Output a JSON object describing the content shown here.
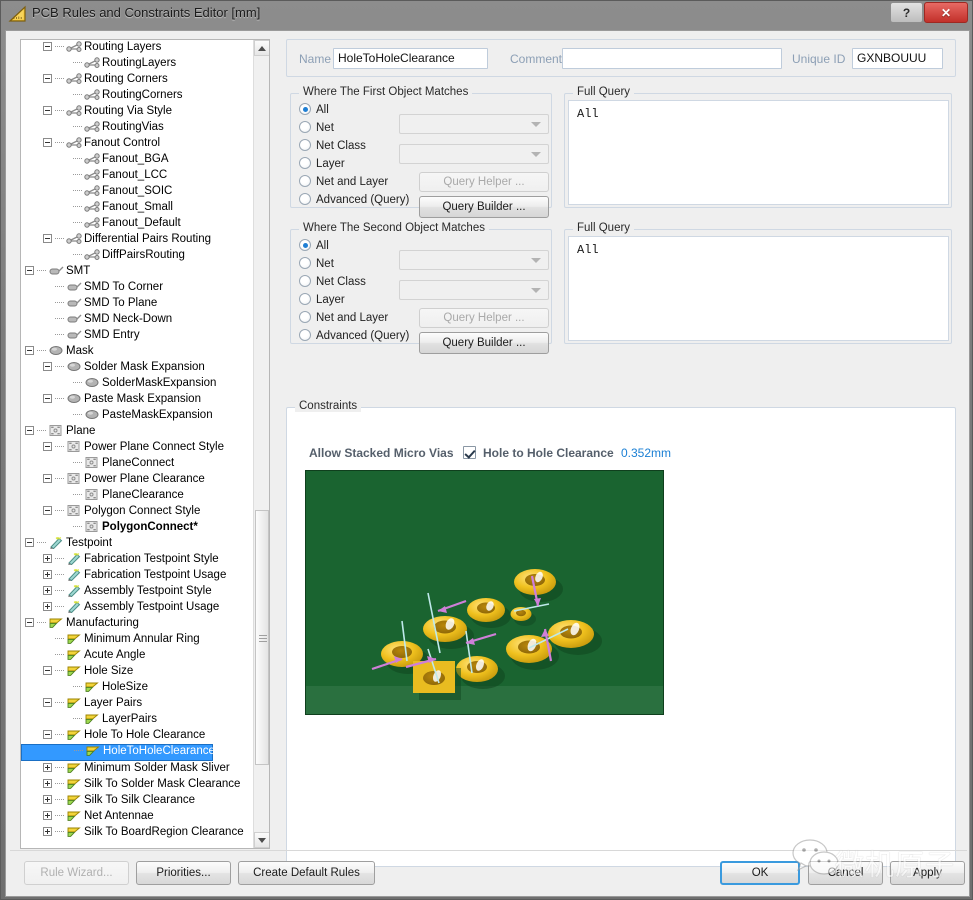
{
  "window": {
    "title": "PCB Rules and Constraints Editor [mm]",
    "icon": "ruler-triangle-icon",
    "help_label": "?",
    "close_label": "✕"
  },
  "tree": {
    "items": [
      {
        "label": "Routing Layers",
        "indent": 2,
        "expander": "minus",
        "icon": "routing-icon"
      },
      {
        "label": "RoutingLayers",
        "indent": 3,
        "expander": "none",
        "icon": "routing-icon"
      },
      {
        "label": "Routing Corners",
        "indent": 2,
        "expander": "minus",
        "icon": "routing-icon"
      },
      {
        "label": "RoutingCorners",
        "indent": 3,
        "expander": "none",
        "icon": "routing-icon"
      },
      {
        "label": "Routing Via Style",
        "indent": 2,
        "expander": "minus",
        "icon": "routing-icon"
      },
      {
        "label": "RoutingVias",
        "indent": 3,
        "expander": "none",
        "icon": "routing-icon"
      },
      {
        "label": "Fanout Control",
        "indent": 2,
        "expander": "minus",
        "icon": "routing-icon"
      },
      {
        "label": "Fanout_BGA",
        "indent": 3,
        "expander": "none",
        "icon": "routing-icon"
      },
      {
        "label": "Fanout_LCC",
        "indent": 3,
        "expander": "none",
        "icon": "routing-icon"
      },
      {
        "label": "Fanout_SOIC",
        "indent": 3,
        "expander": "none",
        "icon": "routing-icon"
      },
      {
        "label": "Fanout_Small",
        "indent": 3,
        "expander": "none",
        "icon": "routing-icon"
      },
      {
        "label": "Fanout_Default",
        "indent": 3,
        "expander": "none",
        "icon": "routing-icon"
      },
      {
        "label": "Differential Pairs Routing",
        "indent": 2,
        "expander": "minus",
        "icon": "routing-icon"
      },
      {
        "label": "DiffPairsRouting",
        "indent": 3,
        "expander": "none",
        "icon": "routing-icon"
      },
      {
        "label": "SMT",
        "indent": 1,
        "expander": "minus",
        "icon": "smt-icon"
      },
      {
        "label": "SMD To Corner",
        "indent": 2,
        "expander": "none",
        "icon": "smt-icon"
      },
      {
        "label": "SMD To Plane",
        "indent": 2,
        "expander": "none",
        "icon": "smt-icon"
      },
      {
        "label": "SMD Neck-Down",
        "indent": 2,
        "expander": "none",
        "icon": "smt-icon"
      },
      {
        "label": "SMD Entry",
        "indent": 2,
        "expander": "none",
        "icon": "smt-icon"
      },
      {
        "label": "Mask",
        "indent": 1,
        "expander": "minus",
        "icon": "mask-icon"
      },
      {
        "label": "Solder Mask Expansion",
        "indent": 2,
        "expander": "minus",
        "icon": "mask-icon"
      },
      {
        "label": "SolderMaskExpansion",
        "indent": 3,
        "expander": "none",
        "icon": "mask-icon"
      },
      {
        "label": "Paste Mask Expansion",
        "indent": 2,
        "expander": "minus",
        "icon": "mask-icon"
      },
      {
        "label": "PasteMaskExpansion",
        "indent": 3,
        "expander": "none",
        "icon": "mask-icon"
      },
      {
        "label": "Plane",
        "indent": 1,
        "expander": "minus",
        "icon": "plane-icon"
      },
      {
        "label": "Power Plane Connect Style",
        "indent": 2,
        "expander": "minus",
        "icon": "plane-icon"
      },
      {
        "label": "PlaneConnect",
        "indent": 3,
        "expander": "none",
        "icon": "plane-icon"
      },
      {
        "label": "Power Plane Clearance",
        "indent": 2,
        "expander": "minus",
        "icon": "plane-icon"
      },
      {
        "label": "PlaneClearance",
        "indent": 3,
        "expander": "none",
        "icon": "plane-icon"
      },
      {
        "label": "Polygon Connect Style",
        "indent": 2,
        "expander": "minus",
        "icon": "plane-icon"
      },
      {
        "label": "PolygonConnect*",
        "indent": 3,
        "expander": "none",
        "icon": "plane-icon",
        "bold": true
      },
      {
        "label": "Testpoint",
        "indent": 1,
        "expander": "minus",
        "icon": "testpoint-icon"
      },
      {
        "label": "Fabrication Testpoint Style",
        "indent": 2,
        "expander": "plus",
        "icon": "testpoint-icon"
      },
      {
        "label": "Fabrication Testpoint Usage",
        "indent": 2,
        "expander": "plus",
        "icon": "testpoint-icon"
      },
      {
        "label": "Assembly Testpoint Style",
        "indent": 2,
        "expander": "plus",
        "icon": "testpoint-icon"
      },
      {
        "label": "Assembly Testpoint Usage",
        "indent": 2,
        "expander": "plus",
        "icon": "testpoint-icon"
      },
      {
        "label": "Manufacturing",
        "indent": 1,
        "expander": "minus",
        "icon": "manufacturing-icon"
      },
      {
        "label": "Minimum Annular Ring",
        "indent": 2,
        "expander": "none",
        "icon": "manufacturing-icon"
      },
      {
        "label": "Acute Angle",
        "indent": 2,
        "expander": "none",
        "icon": "manufacturing-icon"
      },
      {
        "label": "Hole Size",
        "indent": 2,
        "expander": "minus",
        "icon": "manufacturing-icon"
      },
      {
        "label": "HoleSize",
        "indent": 3,
        "expander": "none",
        "icon": "manufacturing-icon"
      },
      {
        "label": "Layer Pairs",
        "indent": 2,
        "expander": "minus",
        "icon": "manufacturing-icon"
      },
      {
        "label": "LayerPairs",
        "indent": 3,
        "expander": "none",
        "icon": "manufacturing-icon"
      },
      {
        "label": "Hole To Hole Clearance",
        "indent": 2,
        "expander": "minus",
        "icon": "manufacturing-icon"
      },
      {
        "label": "HoleToHoleClearance",
        "indent": 3,
        "expander": "none",
        "icon": "manufacturing-icon",
        "selected": true
      },
      {
        "label": "Minimum Solder Mask Sliver",
        "indent": 2,
        "expander": "plus",
        "icon": "manufacturing-icon"
      },
      {
        "label": "Silk To Solder Mask Clearance",
        "indent": 2,
        "expander": "plus",
        "icon": "manufacturing-icon"
      },
      {
        "label": "Silk To Silk Clearance",
        "indent": 2,
        "expander": "plus",
        "icon": "manufacturing-icon"
      },
      {
        "label": "Net Antennae",
        "indent": 2,
        "expander": "plus",
        "icon": "manufacturing-icon"
      },
      {
        "label": "Silk To BoardRegion Clearance",
        "indent": 2,
        "expander": "plus",
        "icon": "manufacturing-icon"
      }
    ]
  },
  "header": {
    "name_label": "Name",
    "name_value": "HoleToHoleClearance",
    "comment_label": "Comment",
    "comment_value": "",
    "unique_id_label": "Unique ID",
    "unique_id_value": "GXNBOUUU"
  },
  "first_object": {
    "title": "Where The First Object Matches",
    "options": [
      {
        "label": "All",
        "selected": true
      },
      {
        "label": "Net",
        "selected": false
      },
      {
        "label": "Net Class",
        "selected": false
      },
      {
        "label": "Layer",
        "selected": false
      },
      {
        "label": "Net and Layer",
        "selected": false
      },
      {
        "label": "Advanced (Query)",
        "selected": false
      }
    ],
    "query_helper_label": "Query Helper ...",
    "query_builder_label": "Query Builder ...",
    "full_query_title": "Full Query",
    "full_query_value": "All"
  },
  "second_object": {
    "title": "Where The Second Object Matches",
    "options": [
      {
        "label": "All",
        "selected": true
      },
      {
        "label": "Net",
        "selected": false
      },
      {
        "label": "Net Class",
        "selected": false
      },
      {
        "label": "Layer",
        "selected": false
      },
      {
        "label": "Net and Layer",
        "selected": false
      },
      {
        "label": "Advanced (Query)",
        "selected": false
      }
    ],
    "query_helper_label": "Query Helper ...",
    "query_builder_label": "Query Builder ...",
    "full_query_title": "Full Query",
    "full_query_value": "All"
  },
  "constraints": {
    "title": "Constraints",
    "stacked_vias_label": "Allow Stacked Micro Vias",
    "hole_clearance_label": "Hole to Hole Clearance",
    "hole_clearance_checked": true,
    "hole_clearance_value": "0.352mm",
    "value_color": "#1a7fd4"
  },
  "footer": {
    "rule_wizard_label": "Rule Wizard...",
    "rule_wizard_accel": "R",
    "priorities_label": "Priorities...",
    "priorities_accel": "P",
    "create_default_label": "Create Default Rules",
    "create_default_accel": "C",
    "ok_label": "OK",
    "cancel_label": "Cancel",
    "apply_label": "Apply"
  },
  "watermark": {
    "text": "微机原子",
    "icon": "wechat-logo-icon"
  }
}
